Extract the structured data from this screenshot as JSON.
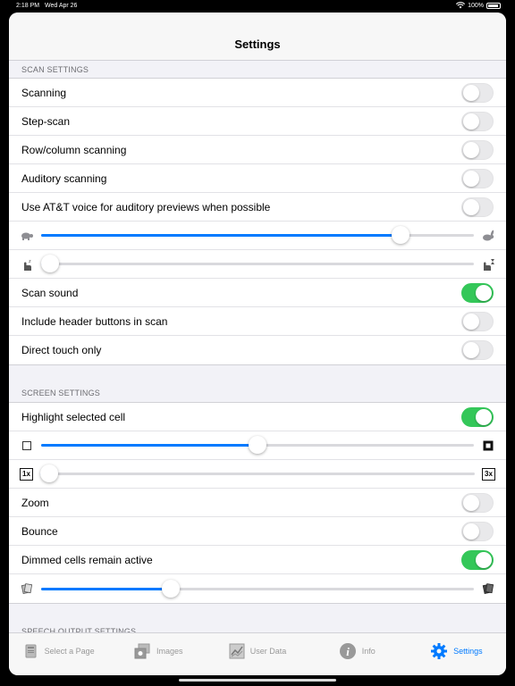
{
  "status_bar": {
    "time": "2:18 PM",
    "date": "Wed Apr 26",
    "battery": "100%"
  },
  "nav": {
    "title": "Settings"
  },
  "scan_settings": {
    "header": "SCAN SETTINGS",
    "scanning": {
      "label": "Scanning",
      "on": false
    },
    "step_scan": {
      "label": "Step-scan",
      "on": false
    },
    "row_column": {
      "label": "Row/column scanning",
      "on": false
    },
    "auditory": {
      "label": "Auditory scanning",
      "on": false
    },
    "att_voice": {
      "label": "Use AT&T voice for auditory previews when possible",
      "on": false
    },
    "speed_slider": {
      "value": 0.83,
      "left_icon": "turtle-icon",
      "right_icon": "rabbit-icon"
    },
    "delay_slider": {
      "value": 0.02,
      "left_icon": "hand-wait-icon",
      "right_icon": "hand-timer-icon"
    },
    "scan_sound": {
      "label": "Scan sound",
      "on": true
    },
    "header_buttons": {
      "label": "Include header buttons in scan",
      "on": false
    },
    "direct_touch": {
      "label": "Direct touch only",
      "on": false
    }
  },
  "screen_settings": {
    "header": "SCREEN SETTINGS",
    "highlight": {
      "label": "Highlight selected cell",
      "on": true
    },
    "border_slider": {
      "value": 0.5,
      "left_icon": "thin-border-icon",
      "right_icon": "thick-border-icon"
    },
    "scale_slider": {
      "value": 0.02,
      "left_label": "1x",
      "right_label": "3x"
    },
    "zoom": {
      "label": "Zoom",
      "on": false
    },
    "bounce": {
      "label": "Bounce",
      "on": false
    },
    "dimmed": {
      "label": "Dimmed cells remain active",
      "on": true
    },
    "dim_slider": {
      "value": 0.3,
      "left_icon": "light-cards-icon",
      "right_icon": "dark-cards-icon"
    }
  },
  "speech_settings": {
    "header": "SPEECH OUTPUT SETTINGS"
  },
  "tabs": [
    {
      "label": "Select a Page",
      "icon": "book-icon",
      "active": false
    },
    {
      "label": "Images",
      "icon": "images-icon",
      "active": false
    },
    {
      "label": "User Data",
      "icon": "chart-icon",
      "active": false
    },
    {
      "label": "Info",
      "icon": "info-icon",
      "active": false
    },
    {
      "label": "Settings",
      "icon": "gear-icon",
      "active": true
    }
  ],
  "colors": {
    "accent": "#007aff",
    "toggle_on": "#34c759",
    "background": "#f2f2f7"
  }
}
